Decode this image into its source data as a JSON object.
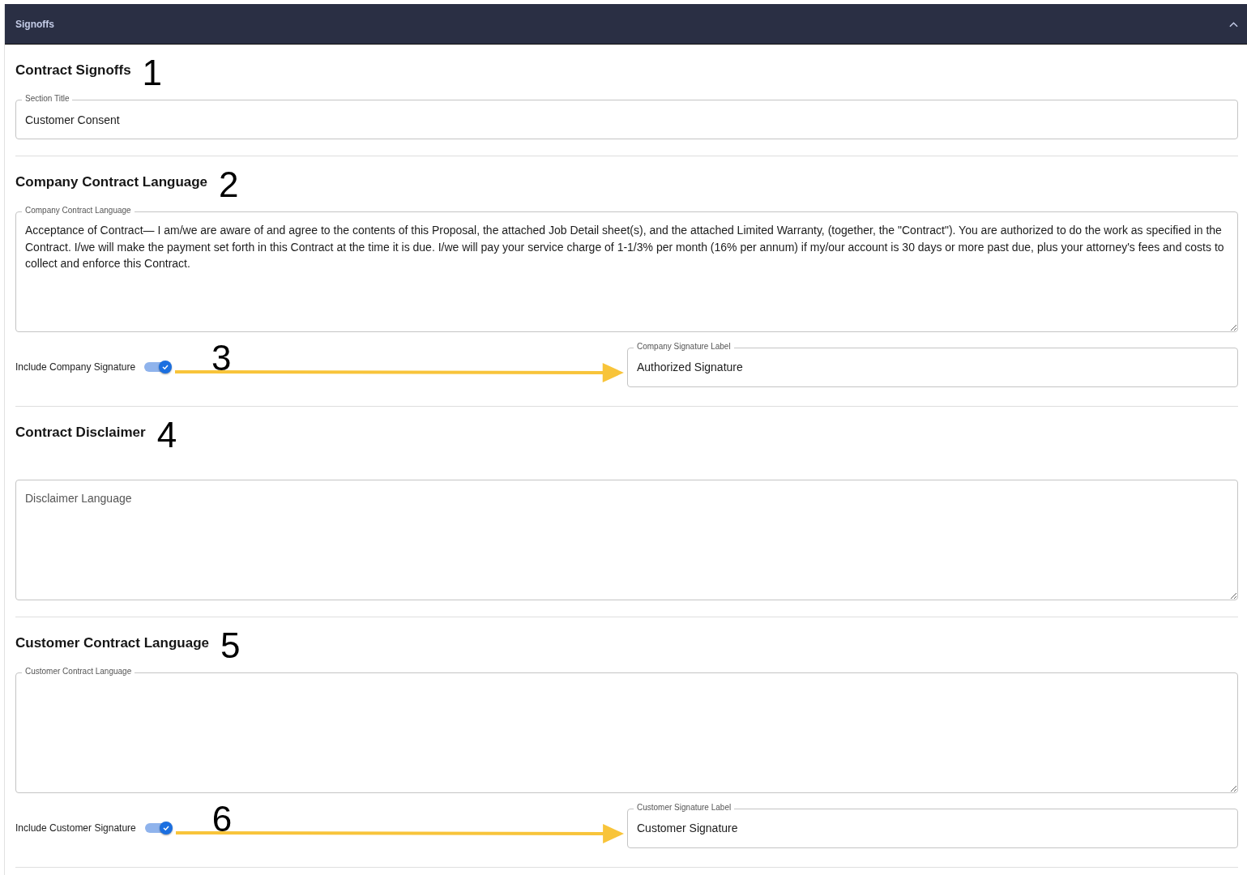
{
  "panel": {
    "title": "Signoffs",
    "expanded": true
  },
  "sections": [
    {
      "kind": "input",
      "heading": "Contract Signoffs",
      "marker": "1",
      "field": {
        "label": "Section Title",
        "value": "Customer Consent"
      }
    },
    {
      "kind": "textarea",
      "heading": "Company Contract Language",
      "marker": "2",
      "field": {
        "label": "Company Contract Language",
        "value": "Acceptance of Contract— I am/we are aware of and agree to the contents of this Proposal, the attached Job Detail sheet(s), and the attached Limited Warranty, (together, the \"Contract\"). You are authorized to do the work as specified in the Contract. I/we will make the payment set forth in this Contract at the time it is due. I/we will pay your service charge of 1-1/3% per month (16% per annum) if my/our account is 30 days or more past due, plus your attorney's fees and costs to collect and enforce this Contract."
      },
      "signature": {
        "label": "Include Company Signature",
        "on": true,
        "marker": "3",
        "field": {
          "label": "Company Signature Label",
          "value": "Authorized Signature"
        }
      }
    },
    {
      "kind": "textarea",
      "heading": "Contract Disclaimer",
      "marker": "4",
      "field": {
        "placeholder": "Disclaimer Language"
      }
    },
    {
      "kind": "textarea",
      "heading": "Customer Contract Language",
      "marker": "5",
      "field": {
        "label": "Customer Contract Language"
      },
      "signature": {
        "label": "Include Customer Signature",
        "on": true,
        "marker": "6",
        "field": {
          "label": "Customer Signature Label",
          "value": "Customer Signature"
        }
      }
    }
  ]
}
